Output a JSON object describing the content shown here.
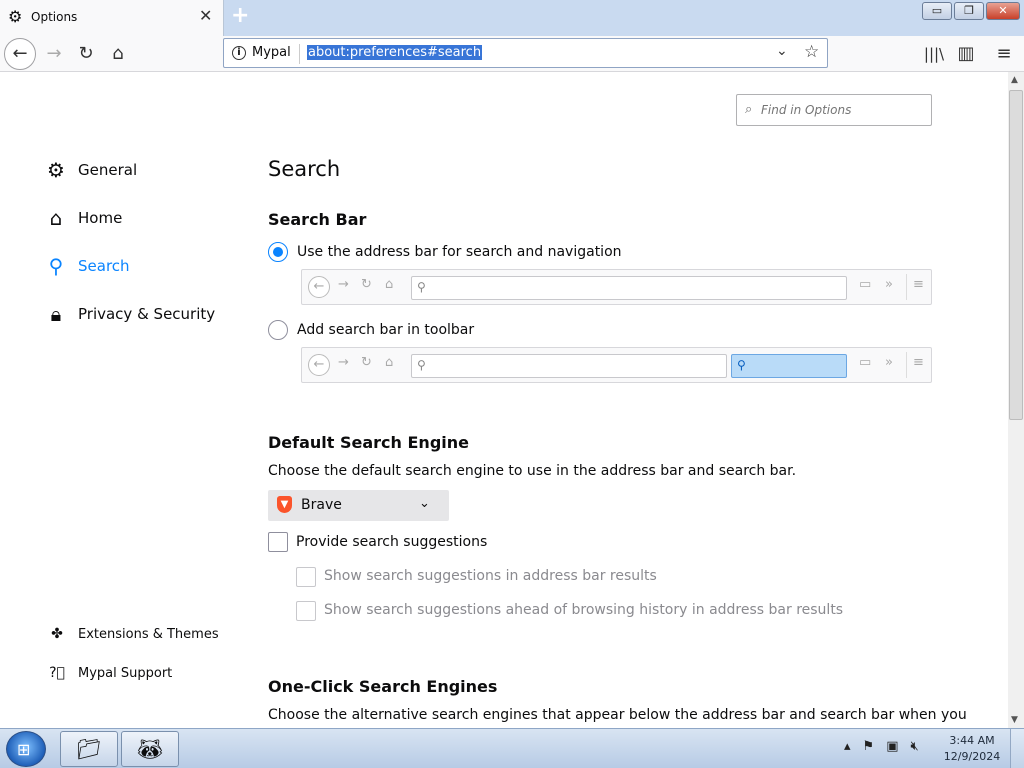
{
  "tab": {
    "title": "Options",
    "icon": "gear-icon",
    "close": "✕"
  },
  "new_tab": "+",
  "window_controls": {
    "minimize": "▭",
    "restore": "❐",
    "close": "✕"
  },
  "nav": {
    "back": "←",
    "forward": "→",
    "reload": "↻",
    "home": "⌂",
    "identity_label": "Mypal",
    "url": "about:preferences#search",
    "library": "|||\\",
    "sidebar": "▥",
    "menu": "≡"
  },
  "find": {
    "placeholder": "Find in Options"
  },
  "categories": [
    {
      "label": "General",
      "icon": "gear-icon"
    },
    {
      "label": "Home",
      "icon": "home-icon"
    },
    {
      "label": "Search",
      "icon": "search-icon"
    },
    {
      "label": "Privacy & Security",
      "icon": "lock-icon"
    }
  ],
  "footer_links": [
    {
      "label": "Extensions & Themes",
      "icon": "puzzle-icon"
    },
    {
      "label": "Mypal Support",
      "icon": "help-icon"
    }
  ],
  "page_title": "Search",
  "search_bar": {
    "heading": "Search Bar",
    "option_address": "Use the address bar for search and navigation",
    "option_toolbar": "Add search bar in toolbar",
    "selected": "address"
  },
  "default_engine": {
    "heading": "Default Search Engine",
    "description": "Choose the default search engine to use in the address bar and search bar.",
    "engine": "Brave"
  },
  "suggestions": {
    "provide": "Provide search suggestions",
    "in_address_bar": "Show search suggestions in address bar results",
    "ahead_of_history": "Show search suggestions ahead of browsing history in address bar results"
  },
  "one_click": {
    "heading": "One-Click Search Engines",
    "description": "Choose the alternative search engines that appear below the address bar and search bar when you"
  },
  "taskbar": {
    "time": "3:44 AM",
    "date": "12/9/2024"
  },
  "colors": {
    "accent": "#0a84ff",
    "selection": "#3875d7",
    "brave": "#fb542b"
  }
}
